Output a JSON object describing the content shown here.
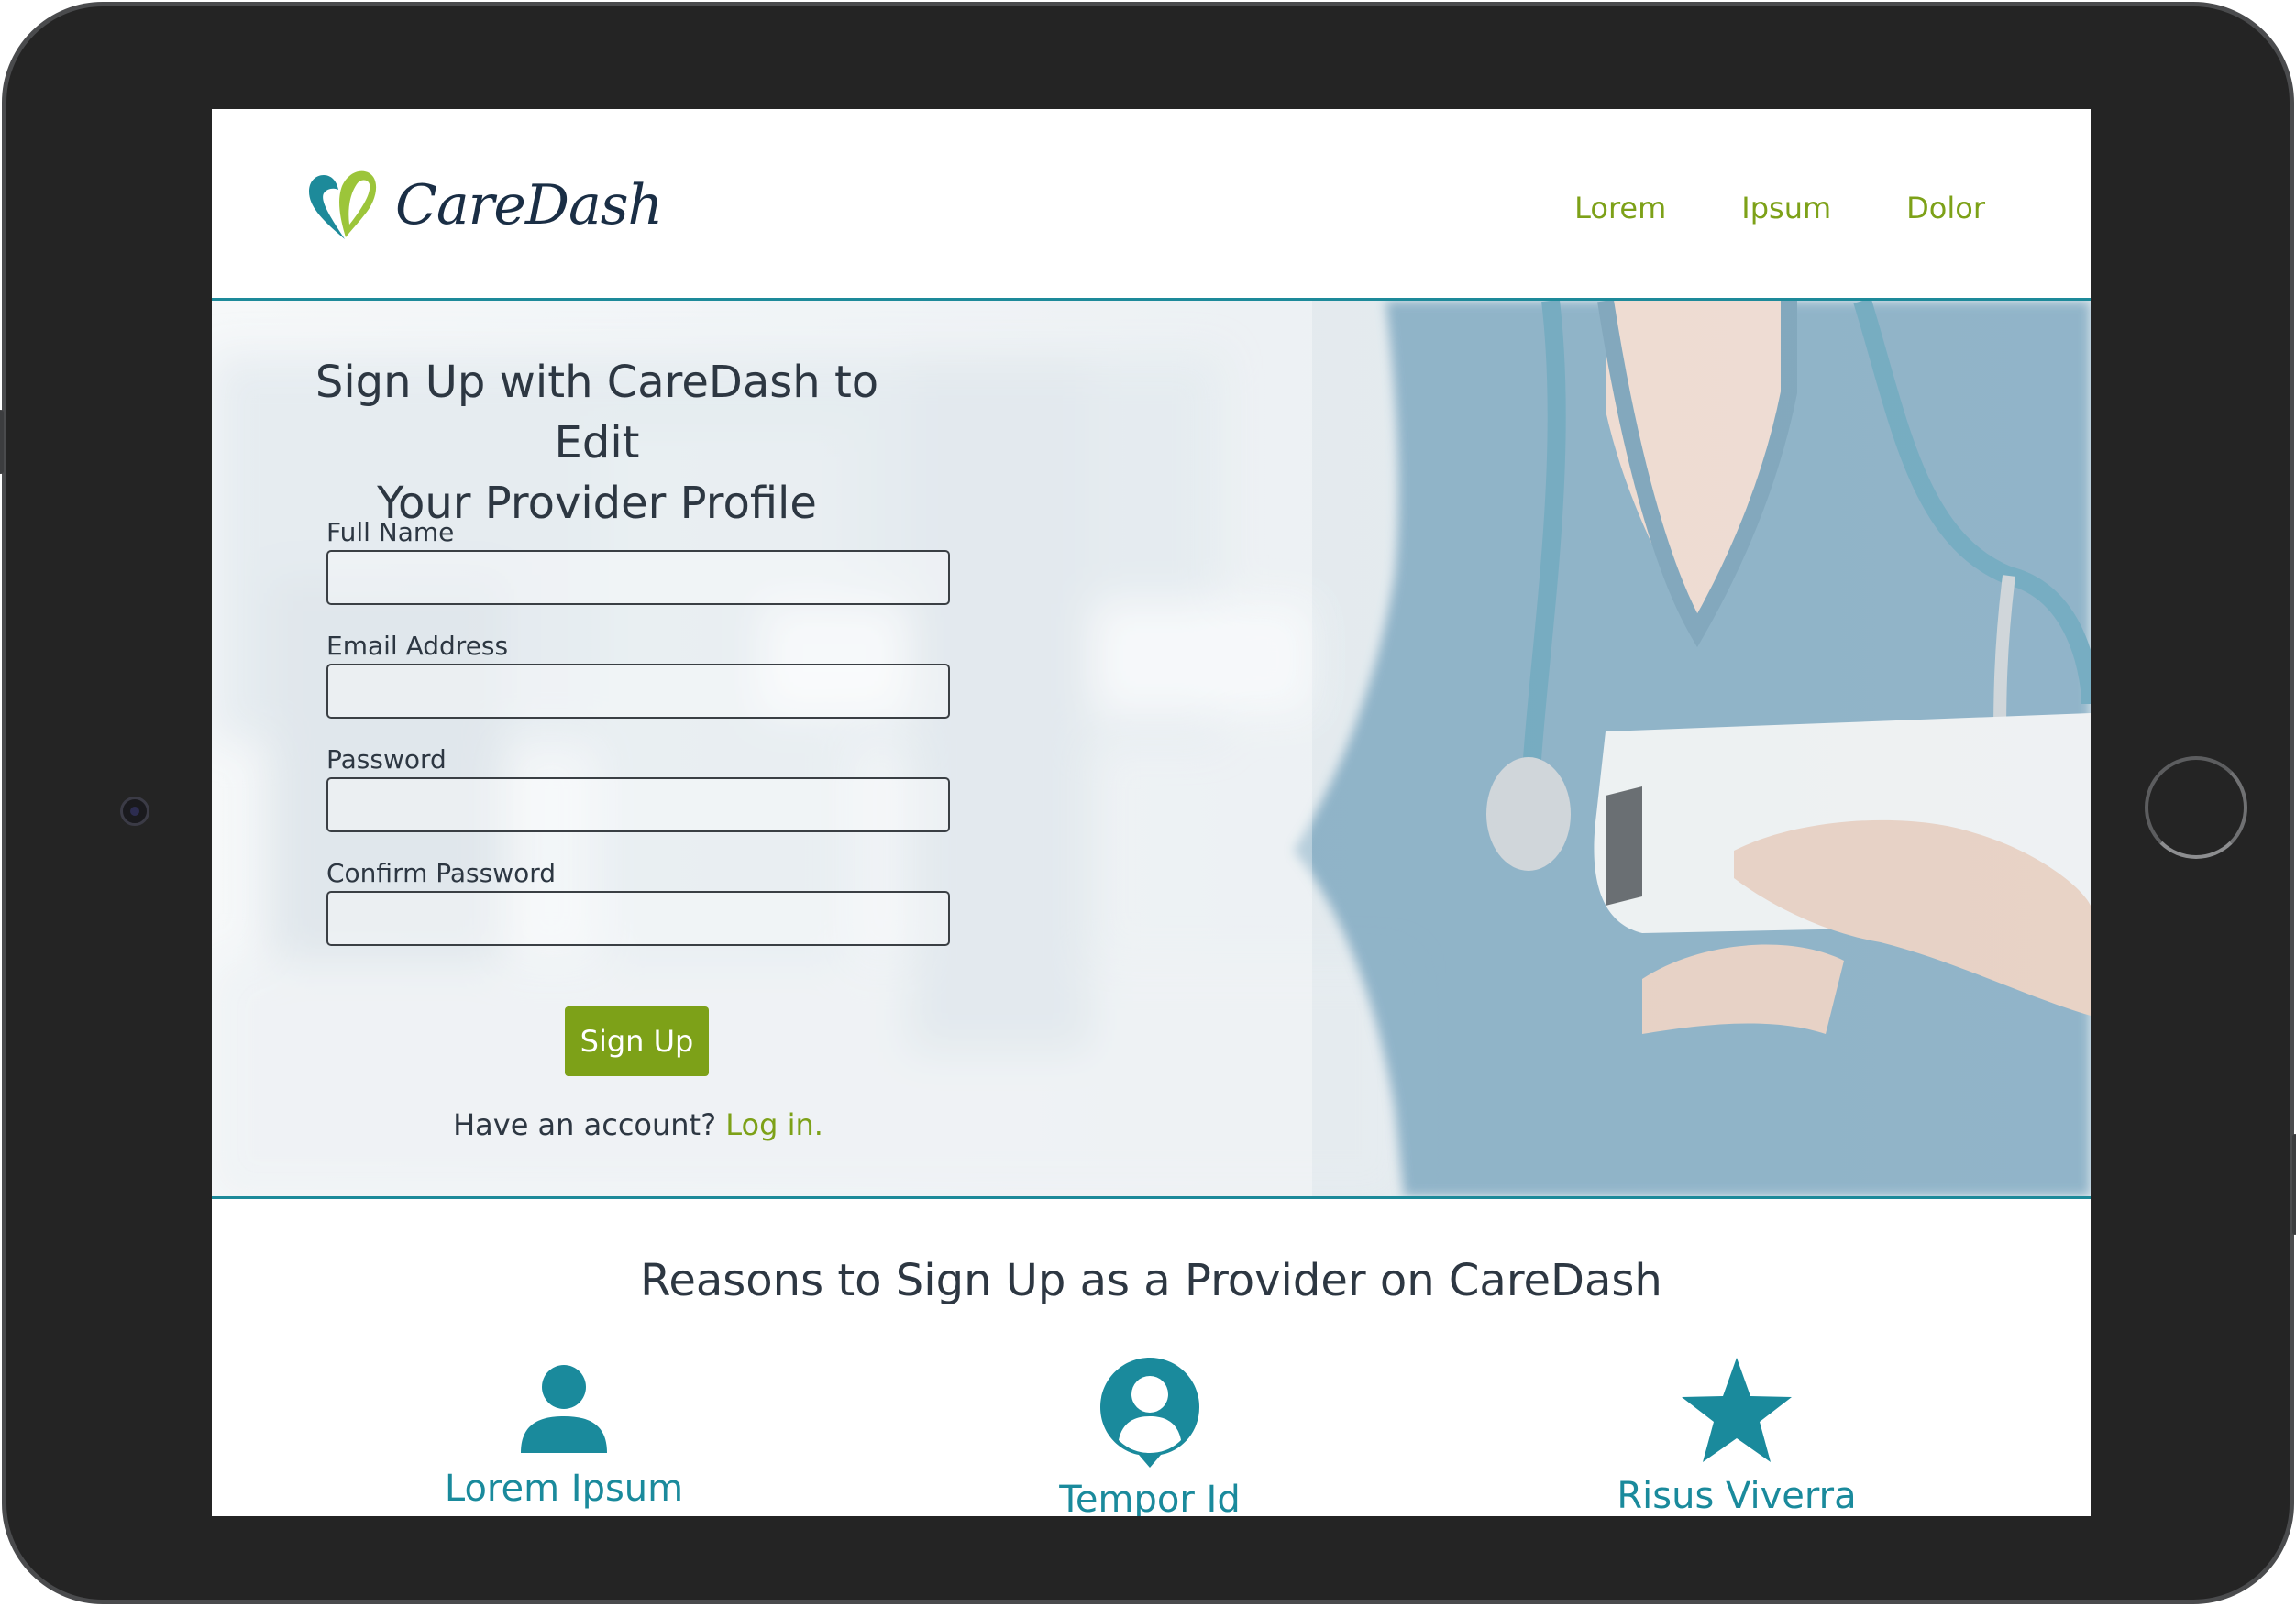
{
  "header": {
    "logo_text": "CareDash",
    "nav": [
      "Lorem",
      "Ipsum",
      "Dolor"
    ]
  },
  "hero": {
    "title_line1": "Sign Up with CareDash to Edit",
    "title_line2": "Your Provider Profile",
    "fields": [
      {
        "label": "Full Name",
        "value": ""
      },
      {
        "label": "Email Address",
        "value": ""
      },
      {
        "label": "Password",
        "value": ""
      },
      {
        "label": "Confirm Password",
        "value": ""
      }
    ],
    "signup_label": "Sign Up",
    "account_prompt": "Have an account?",
    "login_link": "Log in."
  },
  "reasons": {
    "title": "Reasons to Sign Up as a Provider on CareDash",
    "items": [
      {
        "icon": "person-icon",
        "label": "Lorem Ipsum"
      },
      {
        "icon": "profile-pin-icon",
        "label": "Tempor Id"
      },
      {
        "icon": "star-icon",
        "label": "Risus Viverra"
      }
    ]
  },
  "colors": {
    "accent_green": "#7da118",
    "accent_teal": "#1a8a9c",
    "text_dark": "#2d3742",
    "frame": "#242424"
  }
}
